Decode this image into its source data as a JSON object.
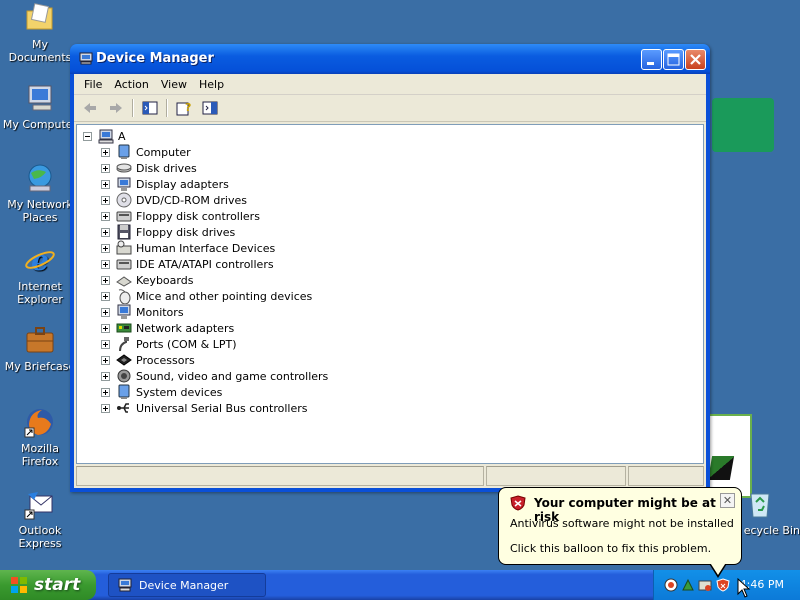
{
  "desktop": {
    "icons": [
      {
        "label": "My Documents",
        "icon": "my-documents-icon"
      },
      {
        "label": "My Computer",
        "icon": "my-computer-icon"
      },
      {
        "label": "My Network Places",
        "icon": "network-places-icon"
      },
      {
        "label": "Internet Explorer",
        "icon": "internet-explorer-icon"
      },
      {
        "label": "My Briefcase",
        "icon": "briefcase-icon"
      },
      {
        "label": "Mozilla Firefox",
        "icon": "firefox-icon"
      },
      {
        "label": "Outlook Express",
        "icon": "outlook-express-icon"
      },
      {
        "label": "ecycle Bin",
        "icon": "recycle-bin-icon"
      }
    ]
  },
  "window": {
    "title": "Device Manager",
    "menu": [
      "File",
      "Action",
      "View",
      "Help"
    ],
    "tree": {
      "root": "A",
      "items": [
        "Computer",
        "Disk drives",
        "Display adapters",
        "DVD/CD-ROM drives",
        "Floppy disk controllers",
        "Floppy disk drives",
        "Human Interface Devices",
        "IDE ATA/ATAPI controllers",
        "Keyboards",
        "Mice and other pointing devices",
        "Monitors",
        "Network adapters",
        "Ports (COM & LPT)",
        "Processors",
        "Sound, video and game controllers",
        "System devices",
        "Universal Serial Bus controllers"
      ]
    }
  },
  "taskbar": {
    "start_label": "start",
    "task_button": "Device Manager",
    "clock": "4:46 PM"
  },
  "balloon": {
    "title": "Your computer might be at risk",
    "line1": "Antivirus software might not be installed",
    "line2": "Click this balloon to fix this problem.",
    "close": "✕"
  }
}
